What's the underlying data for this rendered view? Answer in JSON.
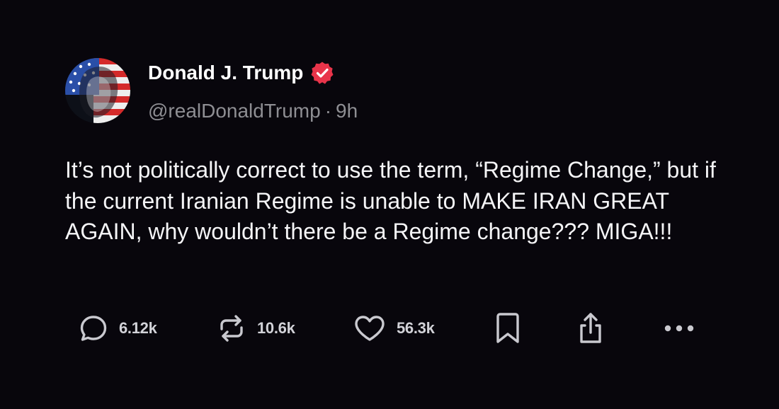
{
  "author": {
    "display_name": "Donald J. Trump",
    "handle": "@realDonaldTrump",
    "separator": "·",
    "time_ago": "9h",
    "verified": true
  },
  "post": {
    "text": "It’s not politically correct to use the term, “Regime Change,” but if the current Iranian Regime is unable to MAKE IRAN GREAT AGAIN, why wouldn’t there be a Regime change??? MIGA!!!"
  },
  "actions": {
    "replies": "6.12k",
    "reposts": "10.6k",
    "likes": "56.3k",
    "icons": [
      "reply-icon",
      "repost-icon",
      "like-icon",
      "bookmark-icon",
      "share-icon",
      "more-icon"
    ]
  },
  "colors": {
    "background": "#08060c",
    "text": "#f5f5f7",
    "muted": "#8e8e93",
    "verified_badge": "#e8344a",
    "icon": "#c9c9cf"
  }
}
